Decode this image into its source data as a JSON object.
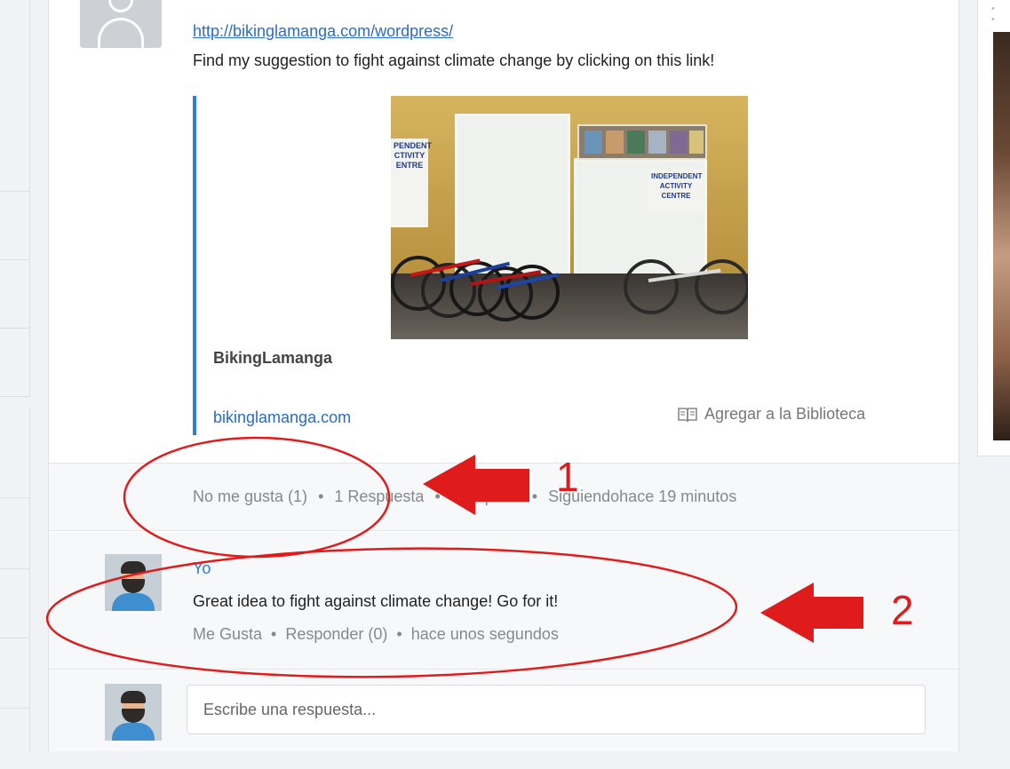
{
  "post": {
    "link": "http://bikinglamanga.com/wordpress/",
    "text": "Find my suggestion to fight against climate change by clicking on this link!",
    "preview": {
      "site_name": "BikingLamanga",
      "domain": "bikinglamanga.com",
      "library_label": "Agregar a la Biblioteca",
      "photo_posters": [
        "PENDENT\nCTIVITY\nENTRE",
        "INDEPENDENT\nACTIVITY\nCENTRE"
      ]
    },
    "actions": {
      "dislike": "No me gusta (1)",
      "replies": "1 Respuesta",
      "share": "Compartir",
      "following": "Siguiendo",
      "time": "hace 19 minutos",
      "separator": "•"
    }
  },
  "reply": {
    "author": "Yo",
    "text": "Great idea to fight against climate change! Go for it!",
    "like": "Me Gusta",
    "respond": "Responder (0)",
    "time": "hace unos segundos",
    "separator": "•"
  },
  "reply_input": {
    "placeholder": "Escribe una respuesta..."
  },
  "annotations": {
    "label_1": "1",
    "label_2": "2",
    "color": "#e01b1b"
  },
  "colors": {
    "link": "#2a6cc8",
    "accent": "#2a7fd8",
    "muted": "#888888"
  }
}
